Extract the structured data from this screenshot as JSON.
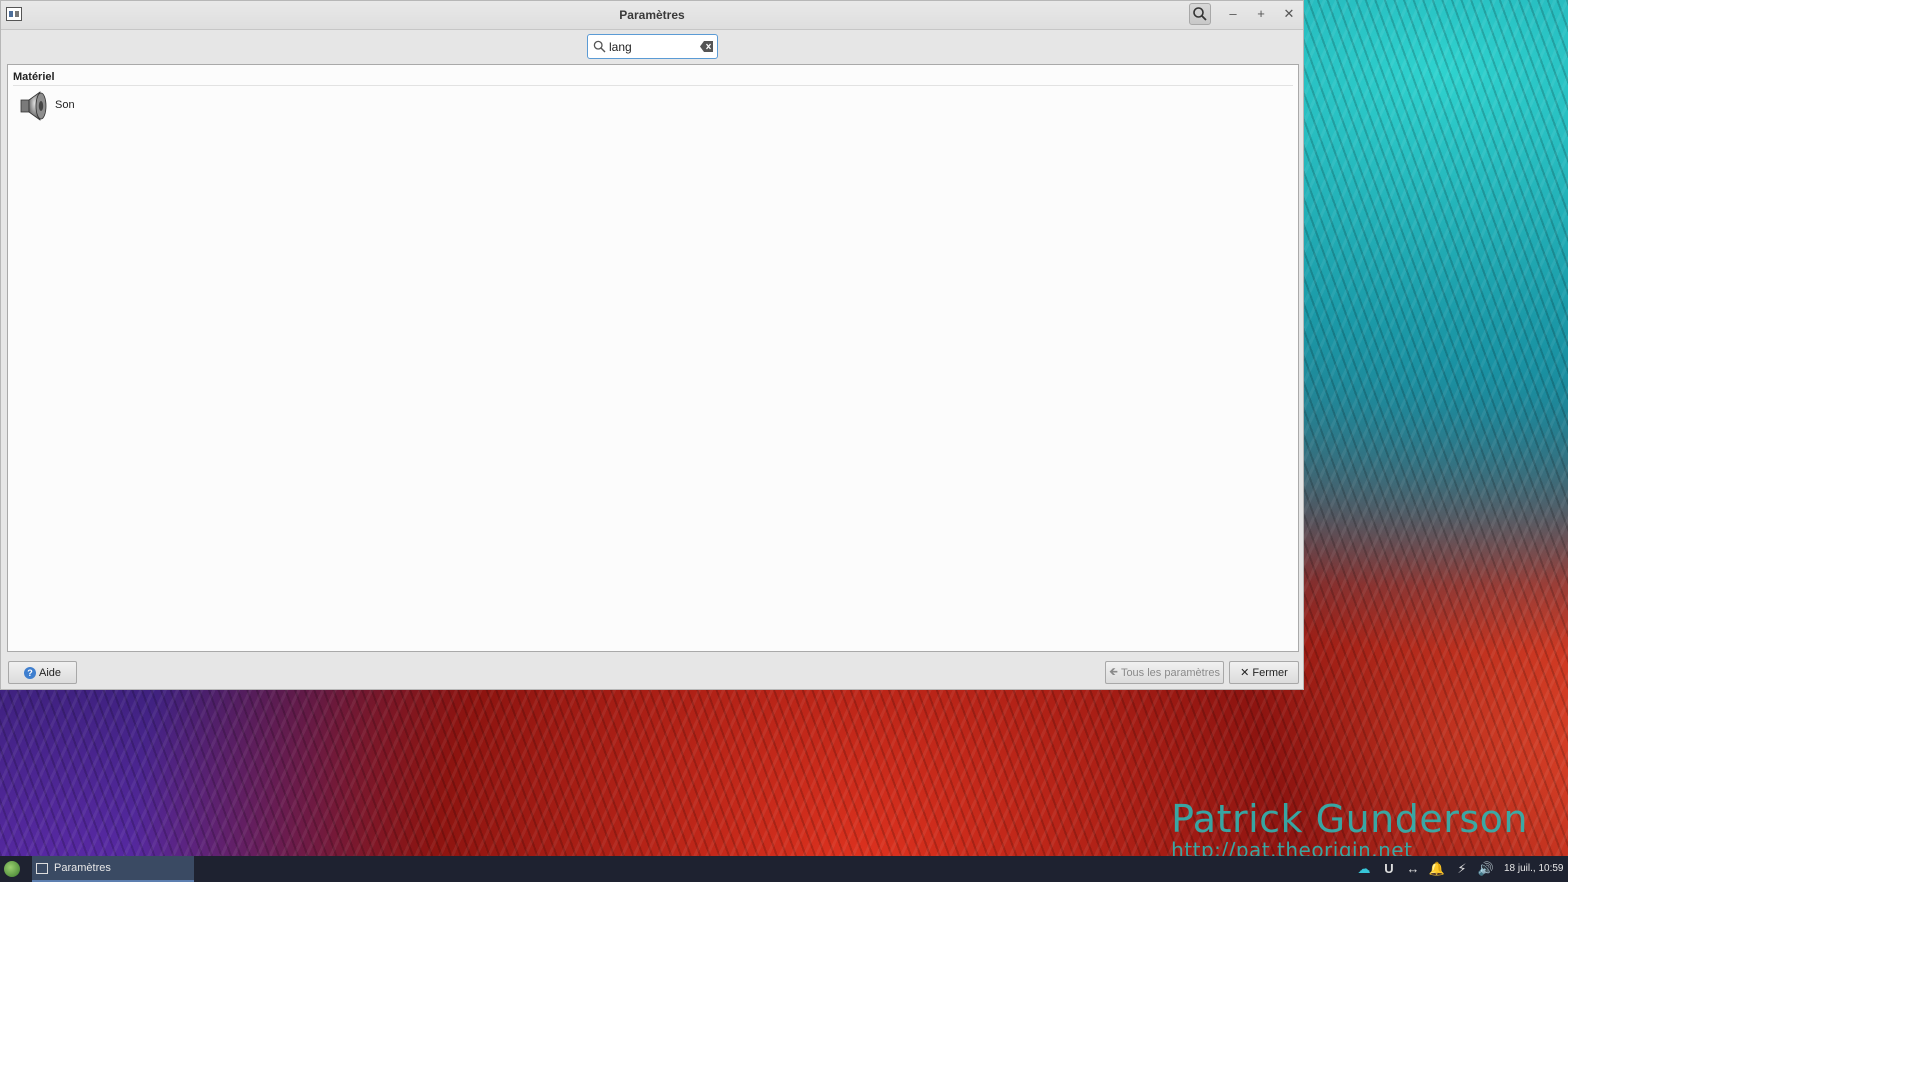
{
  "window": {
    "title": "Paramètres"
  },
  "search": {
    "value": "lang"
  },
  "results": {
    "section_title": "Matériel",
    "items": [
      {
        "label": "Son",
        "icon": "speaker-icon"
      }
    ]
  },
  "buttons": {
    "help": "Aide",
    "all_settings": "Tous les paramètres",
    "close": "Fermer"
  },
  "taskbar": {
    "task_label": "Paramètres",
    "clock": "18 juil., 10:59"
  },
  "wallpaper": {
    "author": "Patrick Gunderson",
    "url": "http://pat.theorigin.net"
  }
}
